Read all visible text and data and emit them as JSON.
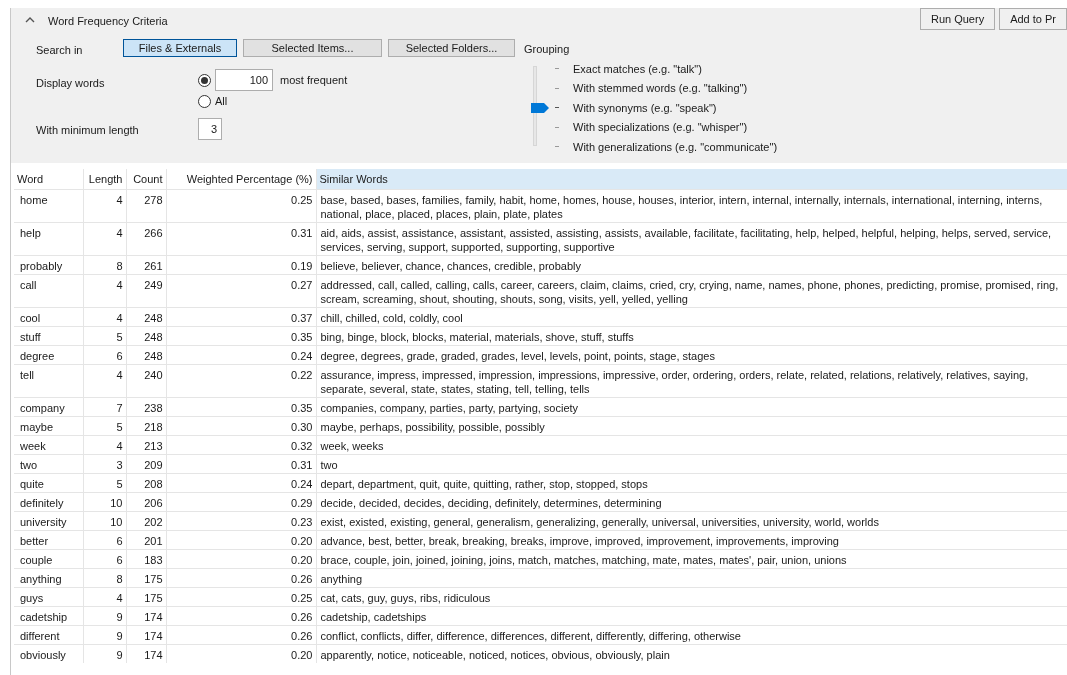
{
  "panel": {
    "title": "Word Frequency Criteria",
    "expanded": true
  },
  "actions": [
    "Run Query",
    "Add to Pr"
  ],
  "search_in": {
    "label": "Search in",
    "options": [
      {
        "label": "Files & Externals",
        "selected": true
      },
      {
        "label": "Selected Items...",
        "selected": false
      },
      {
        "label": "Selected Folders...",
        "selected": false
      }
    ]
  },
  "display_words": {
    "label": "Display words",
    "options": [
      {
        "kind": "count",
        "selected": true,
        "value": "100",
        "suffix": "most frequent"
      },
      {
        "kind": "all",
        "selected": false,
        "label": "All"
      }
    ]
  },
  "minimum_length": {
    "label": "With minimum length",
    "value": "3"
  },
  "grouping": {
    "label": "Grouping",
    "options": [
      {
        "label": "Exact matches (e.g. \"talk\")",
        "selected": false
      },
      {
        "label": "With stemmed words (e.g. \"talking\")",
        "selected": false
      },
      {
        "label": "With synonyms (e.g. \"speak\")",
        "selected": true
      },
      {
        "label": "With specializations (e.g. \"whisper\")",
        "selected": false
      },
      {
        "label": "With generalizations (e.g. \"communicate\")",
        "selected": false
      }
    ]
  },
  "table": {
    "columns": [
      {
        "label": "Word",
        "selected": false
      },
      {
        "label": "Length",
        "selected": false
      },
      {
        "label": "Count",
        "selected": false
      },
      {
        "label": "Weighted Percentage (%)",
        "selected": false
      },
      {
        "label": "Similar Words",
        "selected": true
      }
    ],
    "rows": [
      [
        "home",
        "4",
        "278",
        "0.25",
        "base, based, bases, families, family, habit, home, homes, house, houses, interior, intern, internal, internally, internals, international, interning, interns, national, place, placed, places, plain, plate, plates"
      ],
      [
        "help",
        "4",
        "266",
        "0.31",
        "aid, aids, assist, assistance, assistant, assisted, assisting, assists, available, facilitate, facilitating, help, helped, helpful, helping, helps, served, service, services, serving, support, supported, supporting, supportive"
      ],
      [
        "probably",
        "8",
        "261",
        "0.19",
        "believe, believer, chance, chances, credible, probably"
      ],
      [
        "call",
        "4",
        "249",
        "0.27",
        "addressed, call, called, calling, calls, career, careers, claim, claims, cried, cry, crying, name, names, phone, phones, predicting, promise, promised, ring, scream, screaming, shout, shouting, shouts, song, visits, yell, yelled, yelling"
      ],
      [
        "cool",
        "4",
        "248",
        "0.37",
        "chill, chilled, cold, coldly, cool"
      ],
      [
        "stuff",
        "5",
        "248",
        "0.35",
        "bing, binge, block, blocks, material, materials, shove, stuff, stuffs"
      ],
      [
        "degree",
        "6",
        "248",
        "0.24",
        "degree, degrees, grade, graded, grades, level, levels, point, points, stage, stages"
      ],
      [
        "tell",
        "4",
        "240",
        "0.22",
        "assurance, impress, impressed, impression, impressions, impressive, order, ordering, orders, relate, related, relations, relatively, relatives, saying, separate, several, state, states, stating, tell, telling, tells"
      ],
      [
        "company",
        "7",
        "238",
        "0.35",
        "companies, company, parties, party, partying, society"
      ],
      [
        "maybe",
        "5",
        "218",
        "0.30",
        "maybe, perhaps, possibility, possible, possibly"
      ],
      [
        "week",
        "4",
        "213",
        "0.32",
        "week, weeks"
      ],
      [
        "two",
        "3",
        "209",
        "0.31",
        "two"
      ],
      [
        "quite",
        "5",
        "208",
        "0.24",
        "depart, department, quit, quite, quitting, rather, stop, stopped, stops"
      ],
      [
        "definitely",
        "10",
        "206",
        "0.29",
        "decide, decided, decides, deciding, definitely, determines, determining"
      ],
      [
        "university",
        "10",
        "202",
        "0.23",
        "exist, existed, existing, general, generalism, generalizing, generally, universal, universities, university, world, worlds"
      ],
      [
        "better",
        "6",
        "201",
        "0.20",
        "advance, best, better, break, breaking, breaks, improve, improved, improvement, improvements, improving"
      ],
      [
        "couple",
        "6",
        "183",
        "0.20",
        "brace, couple, join, joined, joining, joins, match, matches, matching, mate, mates, mates', pair, union, unions"
      ],
      [
        "anything",
        "8",
        "175",
        "0.26",
        "anything"
      ],
      [
        "guys",
        "4",
        "175",
        "0.25",
        "cat, cats, guy, guys, ribs, ridiculous"
      ],
      [
        "cadetship",
        "9",
        "174",
        "0.26",
        "cadetship, cadetships"
      ],
      [
        "different",
        "9",
        "174",
        "0.26",
        "conflict, conflicts, differ, difference, differences, different, differently, differing, otherwise"
      ],
      [
        "obviously",
        "9",
        "174",
        "0.20",
        "apparently, notice, noticeable, noticed, notices, obvious, obviously, plain"
      ]
    ]
  }
}
